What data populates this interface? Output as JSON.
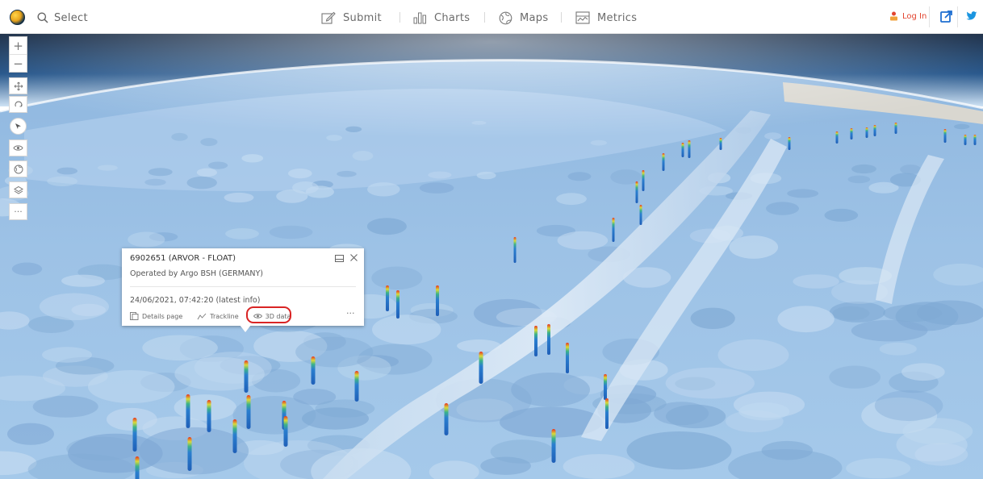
{
  "header": {
    "search": {
      "label": "Select",
      "icon": "search-icon"
    },
    "nav": [
      {
        "label": "Submit",
        "icon": "pencil-square-icon"
      },
      {
        "label": "Charts",
        "icon": "bar-chart-icon"
      },
      {
        "label": "Maps",
        "icon": "globe-icon"
      },
      {
        "label": "Metrics",
        "icon": "metrics-icon"
      }
    ],
    "login_label": "Log In",
    "accent_color": "#e2442f",
    "twitter_color": "#1b95e0"
  },
  "map_tools": {
    "zoom_in": "+",
    "zoom_out": "−",
    "more": "···"
  },
  "popup": {
    "title": "6902651 (ARVOR - FLOAT)",
    "subtitle": "Operated by Argo BSH (GERMANY)",
    "date": "24/06/2021, 07:42:20 (latest info)",
    "actions": [
      {
        "label": "Details page",
        "icon": "details-page-icon"
      },
      {
        "label": "Trackline",
        "icon": "trackline-icon"
      },
      {
        "label": "3D data",
        "icon": "eye-icon",
        "highlighted": true
      }
    ],
    "more": "···",
    "highlight_color": "#d92424"
  },
  "scene": {
    "sky_color": "#0b1f3a",
    "ocean_color": "#9cc2e6",
    "land_color": "#d9d7d0",
    "float_color_bottom": "#1f5fb8",
    "float_color_top": "#e53323"
  }
}
